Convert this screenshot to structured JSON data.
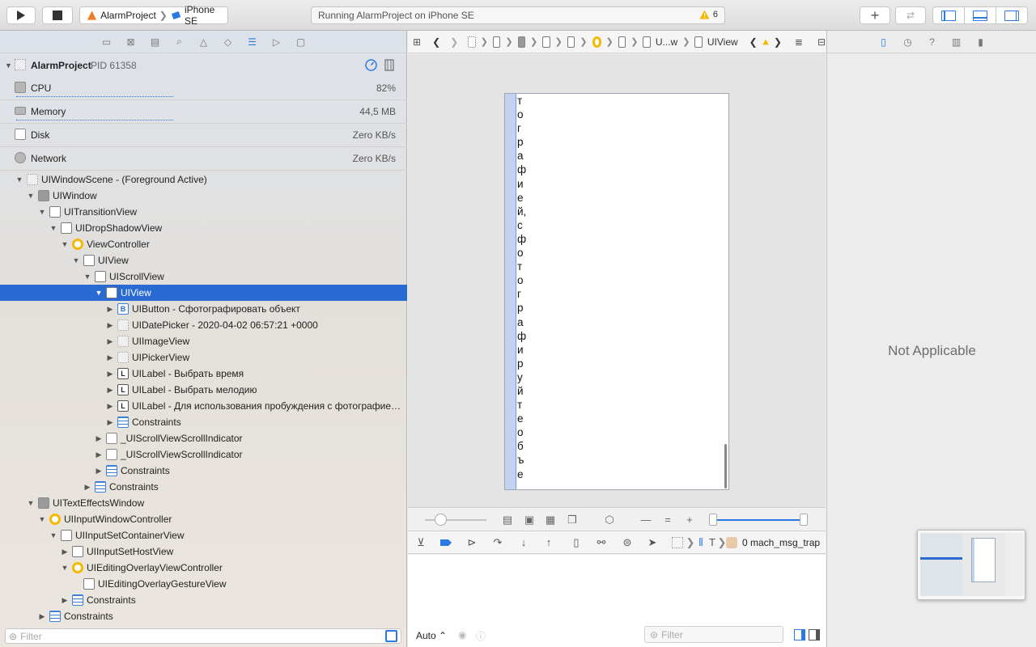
{
  "toolbar": {
    "scheme_project": "AlarmProject",
    "scheme_device": "iPhone SE",
    "activity_text": "Running AlarmProject on iPhone SE",
    "warning_count": "6"
  },
  "navigator": {
    "process_name": "AlarmProject",
    "process_pid": "PID 61358",
    "gauges": [
      {
        "label": "CPU",
        "value": "82%"
      },
      {
        "label": "Memory",
        "value": "44,5 MB"
      },
      {
        "label": "Disk",
        "value": "Zero KB/s"
      },
      {
        "label": "Network",
        "value": "Zero KB/s"
      }
    ],
    "tree": [
      {
        "label": "UIWindowScene - (Foreground Active)"
      },
      {
        "label": "UIWindow"
      },
      {
        "label": "UITransitionView"
      },
      {
        "label": "UIDropShadowView"
      },
      {
        "label": "ViewController"
      },
      {
        "label": "UIView"
      },
      {
        "label": "UIScrollView"
      },
      {
        "label": "UIView"
      },
      {
        "label": "UIButton - Сфотографировать объект"
      },
      {
        "label": "UIDatePicker - 2020-04-02 06:57:21 +0000"
      },
      {
        "label": "UIImageView"
      },
      {
        "label": "UIPickerView"
      },
      {
        "label": "UILabel - Выбрать время"
      },
      {
        "label": "UILabel - Выбрать мелодию"
      },
      {
        "label": "UILabel - Для использования пробуждения с фотографие…"
      },
      {
        "label": "Constraints"
      },
      {
        "label": "_UIScrollViewScrollIndicator"
      },
      {
        "label": "_UIScrollViewScrollIndicator"
      },
      {
        "label": "Constraints"
      },
      {
        "label": "Constraints"
      },
      {
        "label": "UITextEffectsWindow"
      },
      {
        "label": "UIInputWindowController"
      },
      {
        "label": "UIInputSetContainerView"
      },
      {
        "label": "UIInputSetHostView"
      },
      {
        "label": "UIEditingOverlayViewController"
      },
      {
        "label": "UIEditingOverlayGestureView"
      },
      {
        "label": "Constraints"
      },
      {
        "label": "Constraints"
      }
    ],
    "filter_placeholder": "Filter"
  },
  "editor": {
    "jump_truncated": "U...w",
    "jump_current": "UIView",
    "device_text": "тографией, сфотографируйте объе",
    "thread_label": "0 mach_msg_trap",
    "thread_short": "T",
    "console_mode": "Auto",
    "console_filter_placeholder": "Filter"
  },
  "inspector": {
    "empty_text": "Not Applicable"
  }
}
